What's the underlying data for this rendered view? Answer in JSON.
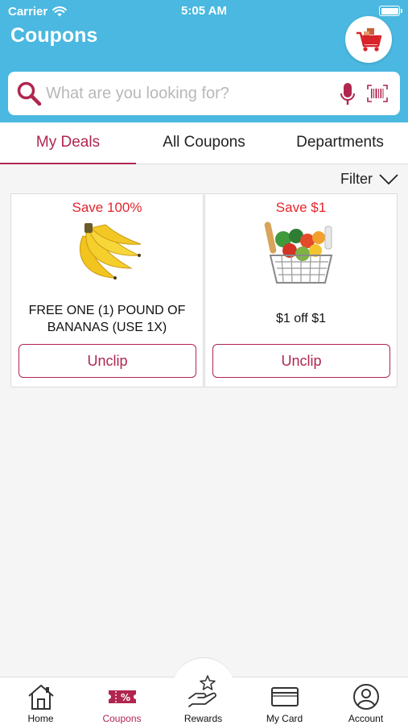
{
  "status_bar": {
    "carrier": "Carrier",
    "time": "5:05 AM"
  },
  "header": {
    "title": "Coupons"
  },
  "search": {
    "placeholder": "What are you looking for?"
  },
  "tabs": [
    {
      "label": "My Deals",
      "active": true
    },
    {
      "label": "All Coupons",
      "active": false
    },
    {
      "label": "Departments",
      "active": false
    }
  ],
  "filter": {
    "label": "Filter"
  },
  "coupons": [
    {
      "save": "Save 100%",
      "description": "FREE ONE (1) POUND OF BANANAS (USE 1X)",
      "action": "Unclip",
      "image": "bananas"
    },
    {
      "save": "Save $1",
      "description": "$1 off $1",
      "action": "Unclip",
      "image": "grocery-basket"
    }
  ],
  "bottom_nav": [
    {
      "label": "Home",
      "icon": "home-icon"
    },
    {
      "label": "Coupons",
      "icon": "coupon-icon",
      "active": true
    },
    {
      "label": "Rewards",
      "icon": "rewards-icon"
    },
    {
      "label": "My Card",
      "icon": "card-icon"
    },
    {
      "label": "Account",
      "icon": "account-icon"
    }
  ],
  "colors": {
    "header": "#4ab8e0",
    "accent": "#b0264f",
    "save": "#e3252c"
  }
}
